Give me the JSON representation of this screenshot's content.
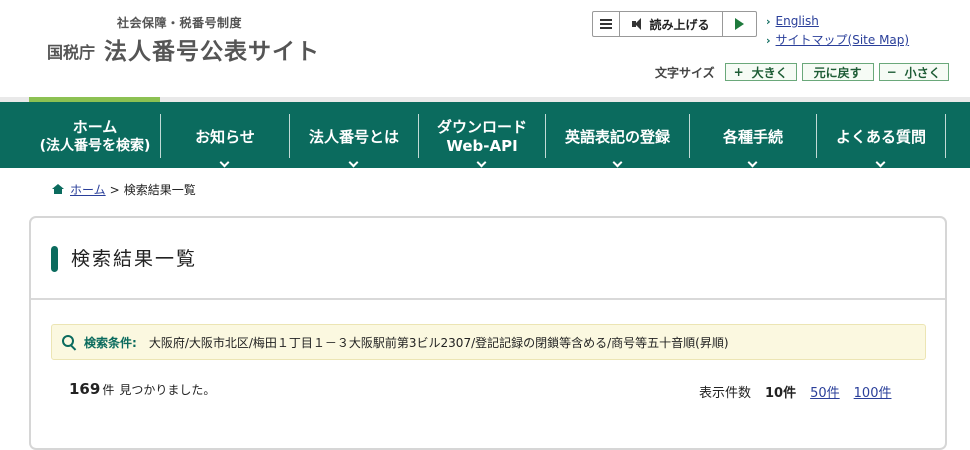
{
  "header": {
    "site_sub": "社会保障・税番号制度",
    "agency": "国税庁",
    "site_name": "法人番号公表サイト",
    "speech": {
      "read_label": "読み上げる"
    },
    "links": [
      {
        "label": "English"
      },
      {
        "label": "サイトマップ(Site Map)"
      }
    ],
    "font_size": {
      "label": "文字サイズ",
      "larger": "大きく",
      "larger_symbol": "+",
      "reset": "元に戻す",
      "smaller": "小さく",
      "smaller_symbol": "−"
    }
  },
  "nav": {
    "items": [
      {
        "line1": "ホーム",
        "line2": "(法人番号を検索)"
      },
      {
        "line1": "お知らせ"
      },
      {
        "line1": "法人番号とは"
      },
      {
        "line1": "ダウンロード",
        "line2": "Web-API"
      },
      {
        "line1": "英語表記の登録"
      },
      {
        "line1": "各種手続"
      },
      {
        "line1": "よくある質問"
      }
    ]
  },
  "breadcrumb": {
    "home": "ホーム",
    "separator": ">",
    "current": "検索結果一覧"
  },
  "main": {
    "title": "検索結果一覧",
    "condition_label": "検索条件:",
    "condition_value": "大阪府/大阪市北区/梅田１丁目１－３大阪駅前第3ビル2307/登記記録の閉鎖等含める/商号等五十音順(昇順)",
    "result_count": "169",
    "result_unit": "件",
    "result_text": "見つかりました。",
    "per_page_label": "表示件数",
    "per_page_current": "10件",
    "per_page_options": [
      "50件",
      "100件"
    ]
  },
  "colors": {
    "nav_bg": "#0b6b5e",
    "accent_green": "#8cc152",
    "link": "#2a3f9a",
    "condition_bg": "#fbf8e0"
  }
}
